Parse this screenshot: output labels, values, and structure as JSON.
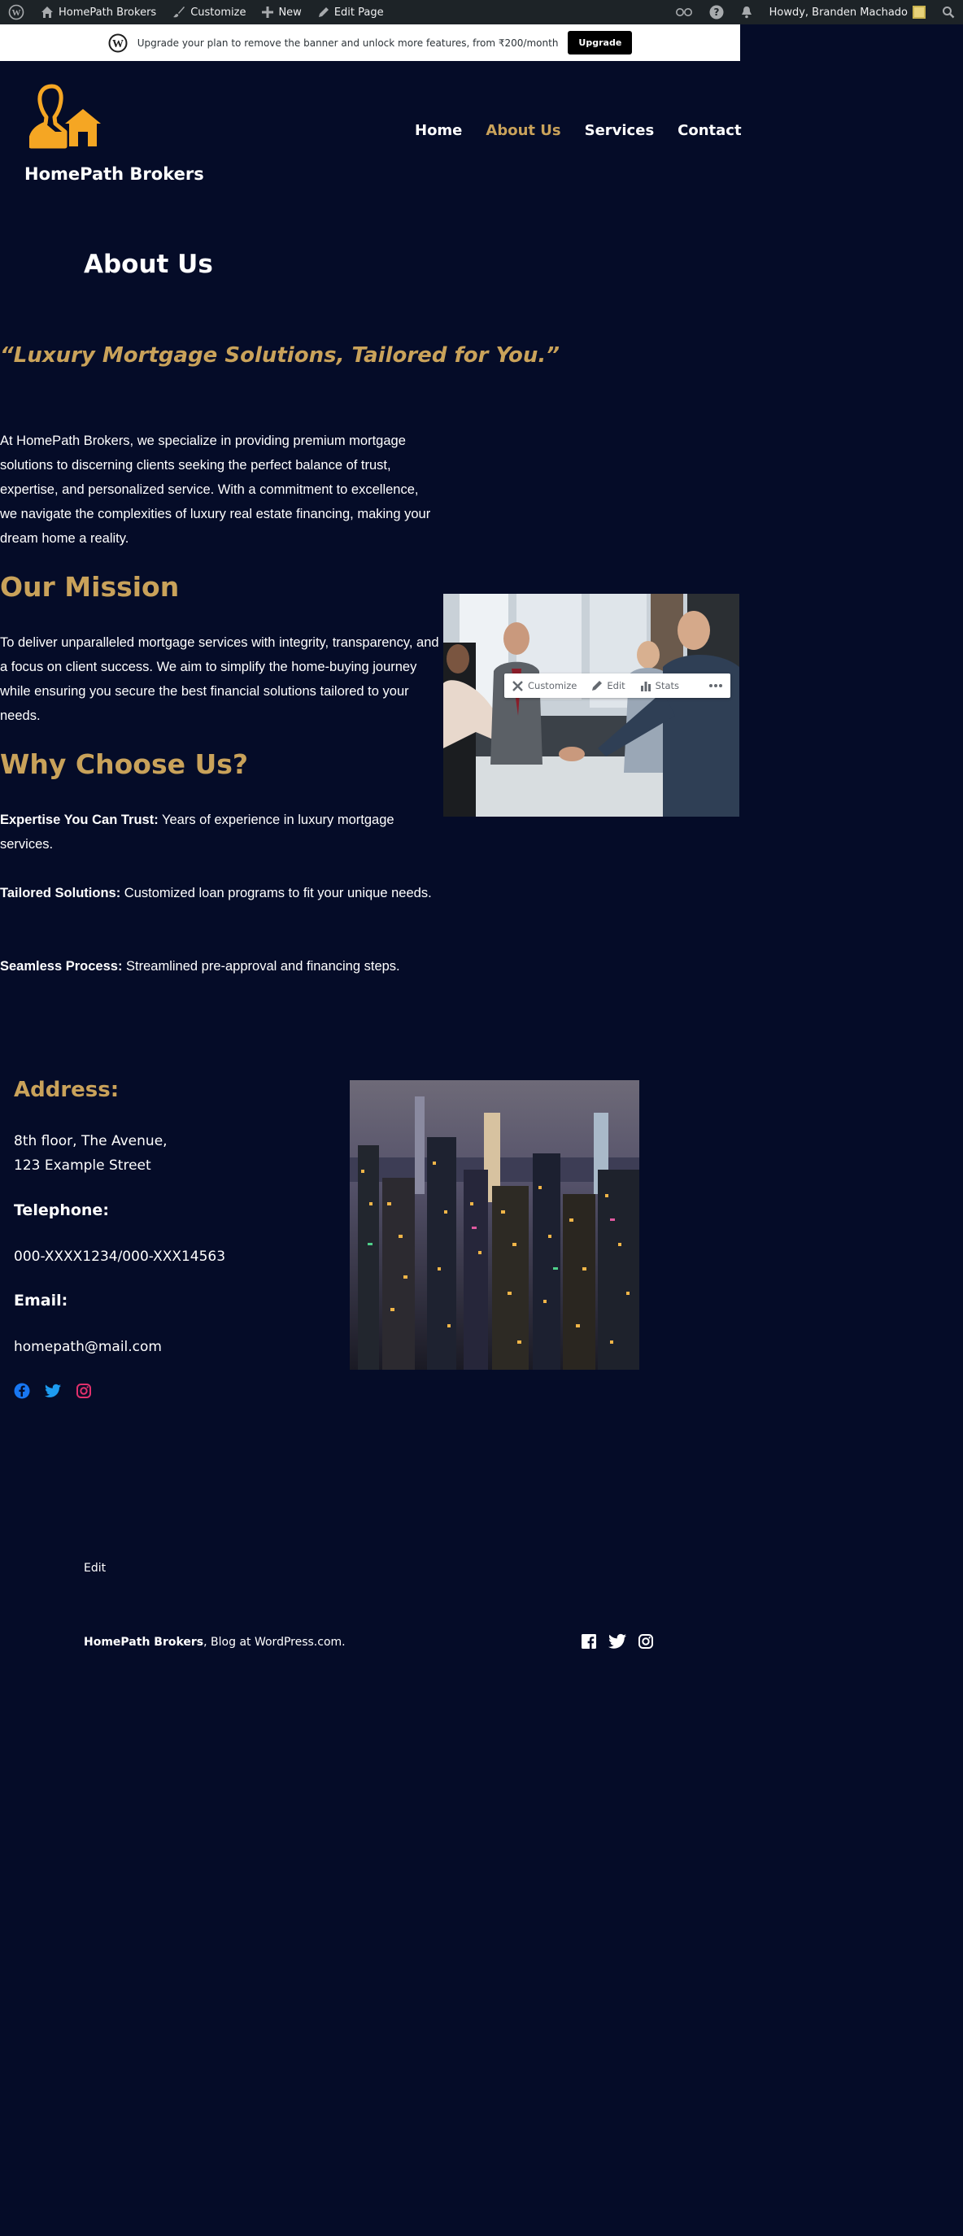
{
  "admin_bar": {
    "site_name": "HomePath Brokers",
    "customize": "Customize",
    "new": "New",
    "edit_page": "Edit Page",
    "howdy": "Howdy, Branden Machado"
  },
  "banner": {
    "message": "Upgrade your plan to remove the banner and unlock more features, from ₹200/month",
    "button": "Upgrade"
  },
  "header": {
    "site_title": "HomePath Brokers",
    "logo_color": "#f5a623",
    "nav": [
      {
        "label": "Home",
        "active": false
      },
      {
        "label": "About Us",
        "active": true
      },
      {
        "label": "Services",
        "active": false
      },
      {
        "label": "Contact",
        "active": false
      }
    ]
  },
  "page": {
    "title": "About Us",
    "tagline": "“Luxury Mortgage Solutions, Tailored for You.”",
    "intro": "At HomePath Brokers, we specialize in providing premium mortgage solutions to discerning clients seeking the perfect balance of trust, expertise, and personalized service. With a commitment to excellence, we navigate the complexities of luxury real estate financing, making your dream home a reality.",
    "mission_heading": "Our Mission",
    "mission_text": "To deliver unparalleled mortgage services with integrity, transparency, and a focus on client success. We aim to simplify the home-buying journey while ensuring you secure the best financial solutions tailored to your needs.",
    "why_heading": "Why Choose Us?",
    "reasons": [
      {
        "title": "Expertise You Can Trust:",
        "text": " Years of experience in luxury mortgage services."
      },
      {
        "title": "Tailored Solutions:",
        "text": " Customized loan programs to fit your unique needs."
      },
      {
        "title": "Seamless Process:",
        "text": " Streamlined pre-approval and financing steps."
      }
    ]
  },
  "image_toolbar": {
    "customize": "Customize",
    "edit": "Edit",
    "stats": "Stats"
  },
  "contact": {
    "address_heading": "Address:",
    "address_line1": "8th floor, The Avenue,",
    "address_line2": "123 Example Street",
    "telephone_heading": "Telephone:",
    "telephone": "000-XXXX1234/000-XXX14563",
    "email_heading": "Email:",
    "email": "homepath@mail.com"
  },
  "footer": {
    "edit": "Edit",
    "site_name": "HomePath Brokers",
    "credit_suffix": ", Blog at WordPress.com."
  },
  "colors": {
    "background": "#050c28",
    "accent": "#c9a25a",
    "facebook": "#1877f2",
    "twitter": "#1d9bf0",
    "instagram": "#e1306c"
  }
}
